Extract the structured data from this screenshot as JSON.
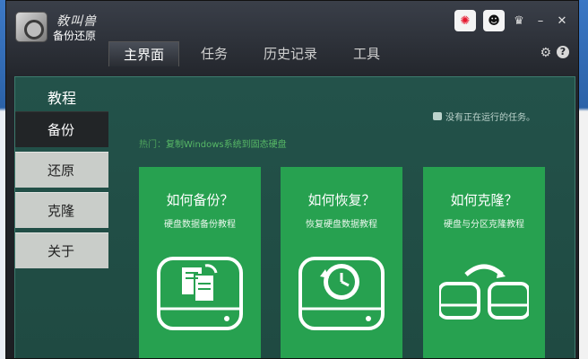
{
  "app": {
    "brand_script": "敎叫兽",
    "brand_sub": "备份还原"
  },
  "tabs": [
    {
      "label": "主界面",
      "active": true
    },
    {
      "label": "任务",
      "active": false
    },
    {
      "label": "历史记录",
      "active": false
    },
    {
      "label": "工具",
      "active": false
    }
  ],
  "content": {
    "title": "教程",
    "status": "没有正在运行的任务。",
    "hot_prefix": "热门：",
    "hot_link": "复制Windows系统到固态硬盘"
  },
  "sidebar": [
    {
      "label": "备份",
      "active": true
    },
    {
      "label": "还原",
      "active": false
    },
    {
      "label": "克隆",
      "active": false
    },
    {
      "label": "关于",
      "active": false
    }
  ],
  "cards": [
    {
      "title": "如何备份？",
      "subtitle": "硬盘数据备份教程",
      "icon": "backup-documents-icon"
    },
    {
      "title": "如何恢复？",
      "subtitle": "恢复硬盘数据教程",
      "icon": "restore-clock-icon"
    },
    {
      "title": "如何克隆？",
      "subtitle": "硬盘与分区克隆教程",
      "icon": "clone-disks-icon"
    }
  ],
  "colors": {
    "accent_green": "#27a150",
    "panel_bg": "#23524a",
    "title_bar": "#23262c"
  }
}
